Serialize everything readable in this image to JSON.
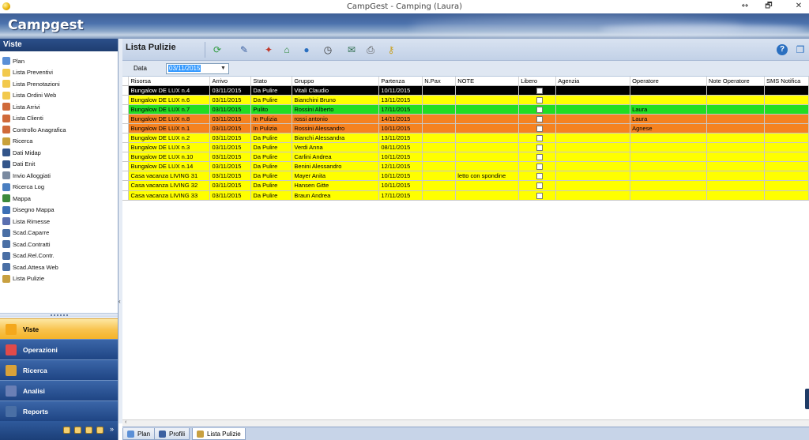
{
  "window": {
    "title": "CampGest - Camping (Laura)",
    "restore_glyph": "↔",
    "maximize_glyph": "🗗",
    "close_glyph": "✕"
  },
  "banner": {
    "brand": "Campgest"
  },
  "sidebar": {
    "header": "Viste",
    "items": [
      {
        "label": "Plan",
        "icon": "plan-icon",
        "color": "#5a8fd6"
      },
      {
        "label": "Lista Preventivi",
        "icon": "folder-icon",
        "color": "#f2c94c"
      },
      {
        "label": "Lista Prenotazioni",
        "icon": "folder-icon",
        "color": "#f2c94c"
      },
      {
        "label": "Lista Ordini Web",
        "icon": "folder-icon",
        "color": "#f2c94c"
      },
      {
        "label": "Lista Arrivi",
        "icon": "users-icon",
        "color": "#d06a3a"
      },
      {
        "label": "Lista Clienti",
        "icon": "users-icon",
        "color": "#d06a3a"
      },
      {
        "label": "Controllo Anagrafica",
        "icon": "users-icon",
        "color": "#d06a3a"
      },
      {
        "label": "Ricerca",
        "icon": "search-icon",
        "color": "#c9a13a"
      },
      {
        "label": "Dati Midap",
        "icon": "document-icon",
        "color": "#33558a"
      },
      {
        "label": "Dati Enit",
        "icon": "document-icon",
        "color": "#33558a"
      },
      {
        "label": "Invio Alloggiati",
        "icon": "document-icon",
        "color": "#7a8aa0"
      },
      {
        "label": "Ricerca Log",
        "icon": "magnifier-icon",
        "color": "#4a7fc1"
      },
      {
        "label": "Mappa",
        "icon": "map-icon",
        "color": "#3c8a3c"
      },
      {
        "label": "Disegno Mappa",
        "icon": "map-draw-icon",
        "color": "#3c6fb5"
      },
      {
        "label": "Lista Rimesse",
        "icon": "users-icon",
        "color": "#5a6fb0"
      },
      {
        "label": "Scad.Caparre",
        "icon": "clock-icon",
        "color": "#4a6fa5"
      },
      {
        "label": "Scad.Contratti",
        "icon": "clock-icon",
        "color": "#4a6fa5"
      },
      {
        "label": "Scad.Rel.Contr.",
        "icon": "clock-icon",
        "color": "#4a6fa5"
      },
      {
        "label": "Scad.Attesa Web",
        "icon": "clock-icon",
        "color": "#4a6fa5"
      },
      {
        "label": "Lista Pulizie",
        "icon": "broom-icon",
        "color": "#c8a040"
      }
    ],
    "nav_buttons": [
      {
        "label": "Viste",
        "icon": "views-icon",
        "active": true
      },
      {
        "label": "Operazioni",
        "icon": "operations-icon",
        "active": false
      },
      {
        "label": "Ricerca",
        "icon": "search-icon",
        "active": false
      },
      {
        "label": "Analisi",
        "icon": "analysis-icon",
        "active": false
      },
      {
        "label": "Reports",
        "icon": "reports-icon",
        "active": false
      }
    ],
    "footer_more": "»"
  },
  "toolbar": {
    "title": "Lista Pulizie",
    "tools": [
      {
        "name": "refresh-icon",
        "glyph": "⟳",
        "color": "#2e9a3e"
      },
      {
        "name": "edit-icon",
        "glyph": "✎",
        "color": "#3a5fa0"
      },
      {
        "name": "status-change-icon",
        "glyph": "✦",
        "color": "#c0392b"
      },
      {
        "name": "house-icon",
        "glyph": "⌂",
        "color": "#2f8a3a"
      },
      {
        "name": "globe-icon",
        "glyph": "●",
        "color": "#2a6fc0"
      },
      {
        "name": "stopwatch-icon",
        "glyph": "◷",
        "color": "#333333"
      },
      {
        "name": "export-excel-icon",
        "glyph": "✉",
        "color": "#2a6a4a"
      },
      {
        "name": "print-icon",
        "glyph": "⎙",
        "color": "#555555"
      },
      {
        "name": "key-icon",
        "glyph": "⚷",
        "color": "#c9a020"
      }
    ],
    "help_glyph": "?",
    "window_glyph": "❐"
  },
  "filter": {
    "label": "Data",
    "date_value": "03/11/2015",
    "dropdown_glyph": "▼"
  },
  "grid": {
    "columns": [
      "Risorsa",
      "Arrivo",
      "Stato",
      "Gruppo",
      "Partenza",
      "N.Pax",
      "NOTE",
      "Libero",
      "Agenzia",
      "Operatore",
      "Note Operatore",
      "SMS Notifica"
    ],
    "rows": [
      {
        "risorsa": "Bungalow DE LUX n.4",
        "arrivo": "03/11/2015",
        "stato": "Da Pulire",
        "gruppo": "Vitali Claudio",
        "partenza": "10/11/2015",
        "npax": "",
        "note": "",
        "agenzia": "",
        "operatore": "",
        "note_operatore": "",
        "sms": "",
        "bg": "#000000",
        "fg": "#ffffff",
        "current": true
      },
      {
        "risorsa": "Bungalow DE LUX n.6",
        "arrivo": "03/11/2015",
        "stato": "Da Pulire",
        "gruppo": "Bianchini Bruno",
        "partenza": "13/11/2015",
        "npax": "",
        "note": "",
        "agenzia": "",
        "operatore": "",
        "note_operatore": "",
        "sms": "",
        "bg": "#ffff00",
        "fg": "#000000"
      },
      {
        "risorsa": "Bungalow DE LUX n.7",
        "arrivo": "03/11/2015",
        "stato": "Pulito",
        "gruppo": "Rossini Alberto",
        "partenza": "17/11/2015",
        "npax": "",
        "note": "",
        "agenzia": "",
        "operatore": "Laura",
        "note_operatore": "",
        "sms": "",
        "bg": "#22dd22",
        "fg": "#000000"
      },
      {
        "risorsa": "Bungalow DE LUX n.8",
        "arrivo": "03/11/2015",
        "stato": "In Pulizia",
        "gruppo": "rossi antonio",
        "partenza": "14/11/2015",
        "npax": "",
        "note": "",
        "agenzia": "",
        "operatore": "Laura",
        "note_operatore": "",
        "sms": "",
        "bg": "#f58220",
        "fg": "#000000"
      },
      {
        "risorsa": "Bungalow DE LUX n.1",
        "arrivo": "03/11/2015",
        "stato": "In Pulizia",
        "gruppo": "Rossini Alessandro",
        "partenza": "10/11/2015",
        "npax": "",
        "note": "",
        "agenzia": "",
        "operatore": "Agnese",
        "note_operatore": "",
        "sms": "",
        "bg": "#f58220",
        "fg": "#000000"
      },
      {
        "risorsa": "Bungalow DE LUX n.2",
        "arrivo": "03/11/2015",
        "stato": "Da Pulire",
        "gruppo": "Bianchi Alessandra",
        "partenza": "13/11/2015",
        "npax": "",
        "note": "",
        "agenzia": "",
        "operatore": "",
        "note_operatore": "",
        "sms": "",
        "bg": "#ffff00",
        "fg": "#000000"
      },
      {
        "risorsa": "Bungalow DE LUX n.3",
        "arrivo": "03/11/2015",
        "stato": "Da Pulire",
        "gruppo": "Verdi Anna",
        "partenza": "08/11/2015",
        "npax": "",
        "note": "",
        "agenzia": "",
        "operatore": "",
        "note_operatore": "",
        "sms": "",
        "bg": "#ffff00",
        "fg": "#000000"
      },
      {
        "risorsa": "Bungalow DE LUX n.10",
        "arrivo": "03/11/2015",
        "stato": "Da Pulire",
        "gruppo": "Carlini Andrea",
        "partenza": "10/11/2015",
        "npax": "",
        "note": "",
        "agenzia": "",
        "operatore": "",
        "note_operatore": "",
        "sms": "",
        "bg": "#ffff00",
        "fg": "#000000"
      },
      {
        "risorsa": "Bungalow DE LUX n.14",
        "arrivo": "03/11/2015",
        "stato": "Da Pulire",
        "gruppo": "Benini Alessandro",
        "partenza": "12/11/2015",
        "npax": "",
        "note": "",
        "agenzia": "",
        "operatore": "",
        "note_operatore": "",
        "sms": "",
        "bg": "#ffff00",
        "fg": "#000000"
      },
      {
        "risorsa": "Casa vacanza LIVING 31",
        "arrivo": "03/11/2015",
        "stato": "Da Pulire",
        "gruppo": "Mayer Anita",
        "partenza": "10/11/2015",
        "npax": "",
        "note": "letto con spondine",
        "agenzia": "",
        "operatore": "",
        "note_operatore": "",
        "sms": "",
        "bg": "#ffff00",
        "fg": "#000000"
      },
      {
        "risorsa": "Casa vacanza LIVING 32",
        "arrivo": "03/11/2015",
        "stato": "Da Pulire",
        "gruppo": "Hansen Gitte",
        "partenza": "10/11/2015",
        "npax": "",
        "note": "",
        "agenzia": "",
        "operatore": "",
        "note_operatore": "",
        "sms": "",
        "bg": "#ffff00",
        "fg": "#000000"
      },
      {
        "risorsa": "Casa vacanza LIVING 33",
        "arrivo": "03/11/2015",
        "stato": "Da Pulire",
        "gruppo": "Braun Andrea",
        "partenza": "17/11/2015",
        "npax": "",
        "note": "",
        "agenzia": "",
        "operatore": "",
        "note_operatore": "",
        "sms": "",
        "bg": "#ffff00",
        "fg": "#000000"
      }
    ]
  },
  "tabs": [
    {
      "label": "Plan",
      "icon": "plan-icon",
      "active": false
    },
    {
      "label": "Profili",
      "icon": "list-icon",
      "active": false
    },
    {
      "label": "Lista Pulizie",
      "icon": "broom-icon",
      "active": true
    }
  ],
  "colors": {
    "accent": "#1e3d70",
    "active_nav": "#f8c24c"
  }
}
